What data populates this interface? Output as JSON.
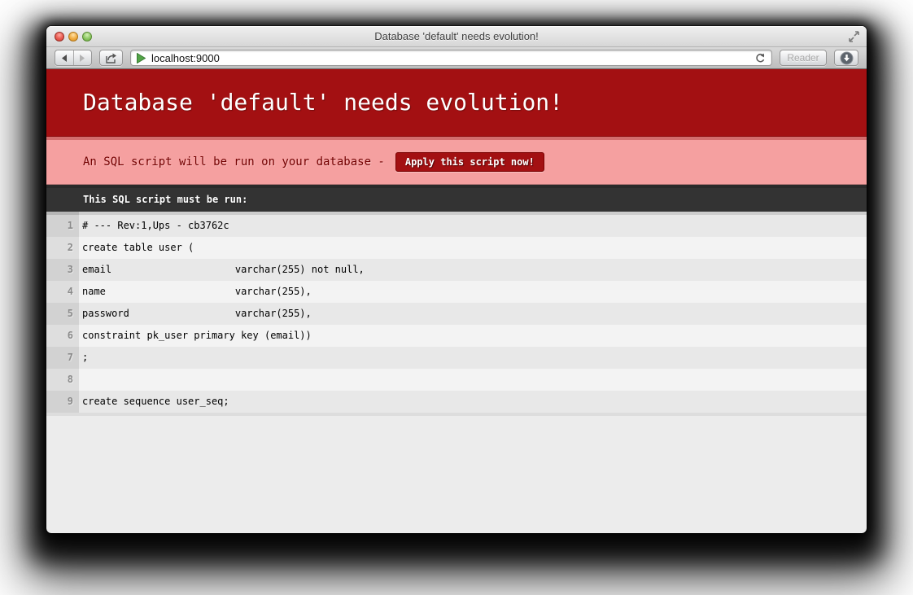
{
  "window": {
    "title": "Database 'default' needs evolution!"
  },
  "browser": {
    "url": "localhost:9000",
    "reader_label": "Reader"
  },
  "content": {
    "heading": "Database 'default' needs evolution!",
    "detail_text": "An SQL script will be run on your database -",
    "apply_button": "Apply this script now!",
    "script_title": "This SQL script must be run:",
    "script_lines": [
      {
        "num": "1",
        "code": "# --- Rev:1,Ups - cb3762c"
      },
      {
        "num": "2",
        "code": "create table user ("
      },
      {
        "num": "3",
        "code": "email                     varchar(255) not null,"
      },
      {
        "num": "4",
        "code": "name                      varchar(255),"
      },
      {
        "num": "5",
        "code": "password                  varchar(255),"
      },
      {
        "num": "6",
        "code": "constraint pk_user primary key (email))"
      },
      {
        "num": "7",
        "code": ";"
      },
      {
        "num": "8",
        "code": ""
      },
      {
        "num": "9",
        "code": "create sequence user_seq;"
      }
    ]
  },
  "colors": {
    "header_background": "#a31012",
    "detail_background": "#f5a0a0",
    "detail_text": "#730000",
    "apply_button_background": "#a31012",
    "script_header_background": "#333333",
    "page_background": "#ececec",
    "gutter_background": "#d6d6d6",
    "favicon_green": "#52a447"
  },
  "icons": {
    "traffic": [
      "close-button",
      "minimize-button",
      "zoom-button"
    ],
    "toolbar": [
      "back-icon",
      "forward-icon",
      "share-icon",
      "play-favicon",
      "reload-icon",
      "download-icon"
    ],
    "titlebar": [
      "fullscreen-icon"
    ]
  }
}
